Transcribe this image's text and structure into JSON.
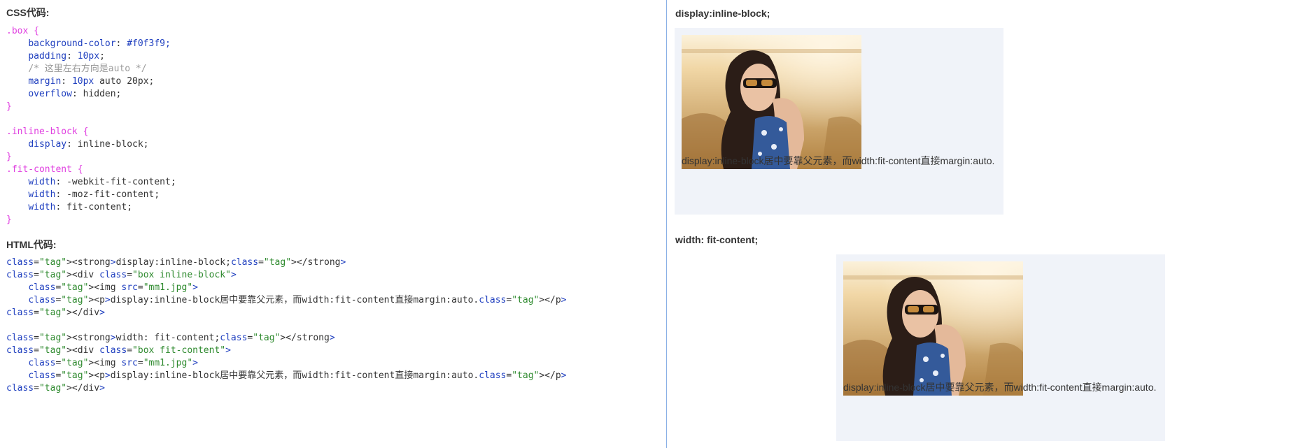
{
  "left": {
    "css_title": "CSS代码:",
    "html_title": "HTML代码:",
    "css_code": [
      {
        "sel": ".box {"
      },
      {
        "prop": "background-color",
        "val": "#f0f3f9;"
      },
      {
        "prop": "padding",
        "val": "10px;"
      },
      {
        "comment": "/* 这里左右方向是auto */"
      },
      {
        "prop": "margin",
        "val": "10px auto 20px;"
      },
      {
        "prop": "overflow",
        "val": "hidden;"
      },
      {
        "close": "}"
      },
      {
        "blank": ""
      },
      {
        "sel": ".inline-block {"
      },
      {
        "prop": "display",
        "val": "inline-block;"
      },
      {
        "close": "}"
      },
      {
        "sel": ".fit-content {"
      },
      {
        "prop": "width",
        "val": "-webkit-fit-content;"
      },
      {
        "prop": "width",
        "val": "-moz-fit-content;"
      },
      {
        "prop": "width",
        "val": "fit-content;"
      },
      {
        "close": "}"
      }
    ],
    "html_code": [
      "<strong>display:inline-block;</strong>",
      "<div class=\"box inline-block\">",
      "    <img src=\"mm1.jpg\">",
      "    <p>display:inline-block居中要靠父元素，而width:fit-content直接margin:auto.</p>",
      "</div>",
      "",
      "<strong>width: fit-content;</strong>",
      "<div class=\"box fit-content\">",
      "    <img src=\"mm1.jpg\">",
      "    <p>display:inline-block居中要靠父元素，而width:fit-content直接margin:auto.</p>",
      "</div>"
    ]
  },
  "right": {
    "demo1_title": "display:inline-block;",
    "demo1_text": "display:inline-block居中要靠父元素，而width:fit-content直接margin:auto.",
    "demo2_title": "width: fit-content;",
    "demo2_text": "display:inline-block居中要靠父元素，而width:fit-content直接margin:auto."
  },
  "colors": {
    "box_bg": "#f0f3f9",
    "divider": "#8ab0e6",
    "selector": "#e040e0",
    "property": "#1f3fbf",
    "string": "#2e8a2e",
    "comment": "#9a9a9a"
  }
}
